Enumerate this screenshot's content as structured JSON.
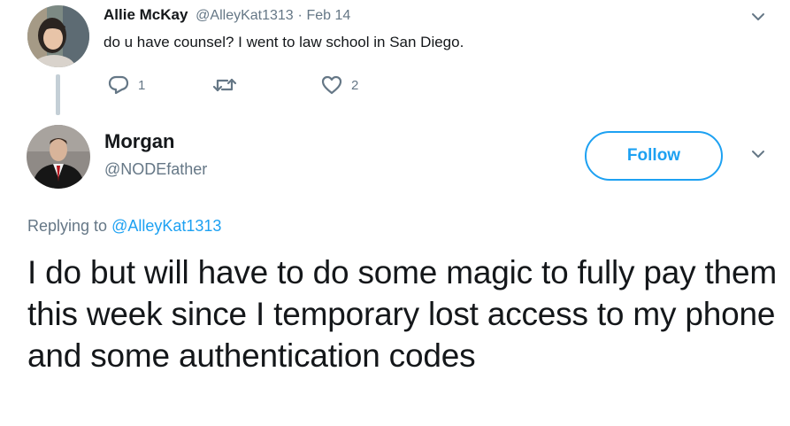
{
  "parent_tweet": {
    "author_name": "Allie McKay",
    "handle": "@AlleyKat1313",
    "separator": "·",
    "date": "Feb 14",
    "text": "do u have counsel?  I went to law school in San Diego.",
    "reply_count": "1",
    "retweet_count": "",
    "like_count": "2",
    "icons": {
      "reply": "reply-icon",
      "retweet": "retweet-icon",
      "like": "heart-icon",
      "more": "chevron-down-icon"
    }
  },
  "main_tweet": {
    "author_name": "Morgan",
    "handle": "@NODEfather",
    "follow_label": "Follow",
    "replying_prefix": "Replying to ",
    "replying_to": "@AlleyKat1313",
    "text": "I do but will have to do some magic to fully pay them this week since I temporary lost access to my phone and some authentication codes",
    "icons": {
      "more": "chevron-down-icon"
    }
  },
  "colors": {
    "accent": "#1da1f2",
    "text_primary": "#14171a",
    "text_secondary": "#657786",
    "thread_line": "#c4cfd6"
  }
}
